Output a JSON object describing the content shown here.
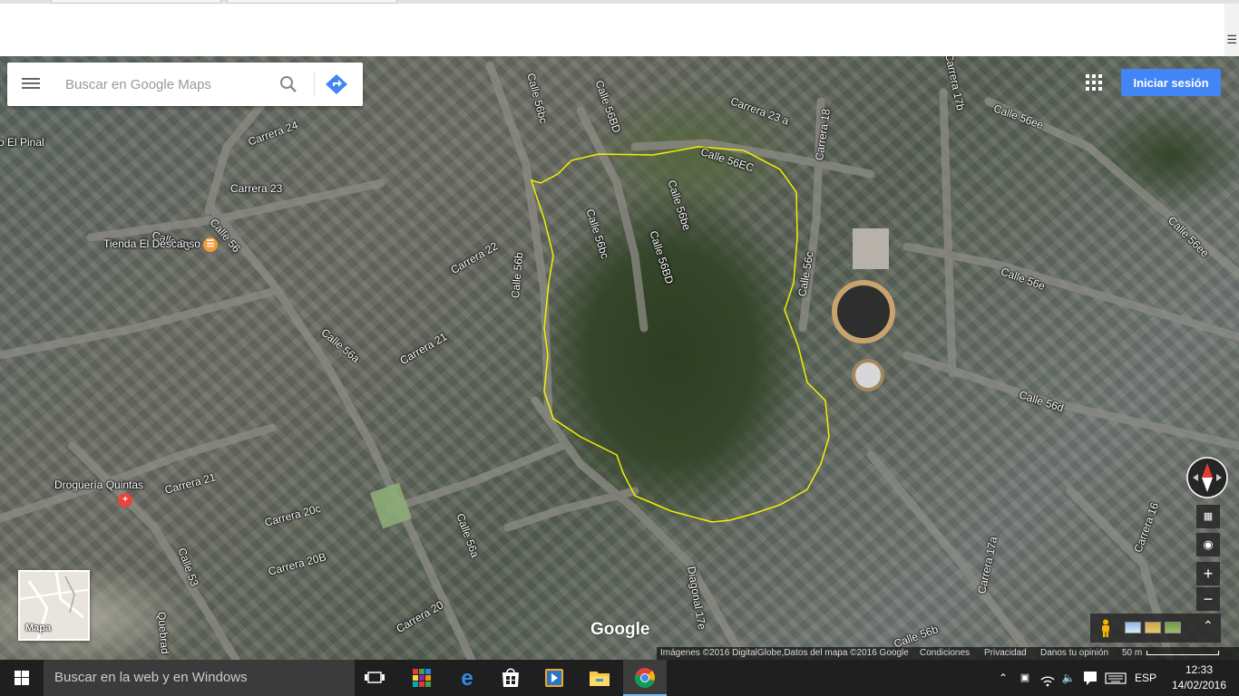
{
  "search": {
    "placeholder": "Buscar en Google Maps"
  },
  "header": {
    "signin_label": "Iniciar sesión"
  },
  "map_labels": [
    {
      "text": "o El Pinal"
    },
    {
      "text": "Carrera 24"
    },
    {
      "text": "Carrera 23"
    },
    {
      "text": "Calle 55"
    },
    {
      "text": "Calle 56"
    },
    {
      "text": "Carrera 22"
    },
    {
      "text": "Calle 56bc"
    },
    {
      "text": "Calle 56BD"
    },
    {
      "text": "Calle 56EC"
    },
    {
      "text": "Carrera 23 a"
    },
    {
      "text": "Carrera 18"
    },
    {
      "text": "Carrera 17b"
    },
    {
      "text": "Calle 56ee"
    },
    {
      "text": "Calle 56ee"
    },
    {
      "text": "Calle 56bc"
    },
    {
      "text": "Calle 56be"
    },
    {
      "text": "Calle 56BD"
    },
    {
      "text": "Calle 56b"
    },
    {
      "text": "Calle 56c"
    },
    {
      "text": "Calle 56e"
    },
    {
      "text": "Calle 56a"
    },
    {
      "text": "Carrera 21"
    },
    {
      "text": "Calle 56d"
    },
    {
      "text": "Carrera 21"
    },
    {
      "text": "Carrera 20c"
    },
    {
      "text": "Calle 53"
    },
    {
      "text": "Carrera 20B"
    },
    {
      "text": "Calle 56a"
    },
    {
      "text": "Carrera 20"
    },
    {
      "text": "Diagonal 17e"
    },
    {
      "text": "Carrera 17a"
    },
    {
      "text": "Carrera 16"
    },
    {
      "text": "Calle 56b"
    },
    {
      "text": "Quebrad"
    }
  ],
  "pois": [
    {
      "name": "Tienda El Descanso",
      "icon": "restaurant-icon",
      "color": "#f29c38"
    },
    {
      "name": "Droguería Quintas",
      "icon": "pharmacy-icon",
      "color": "#e8453c"
    }
  ],
  "minimap": {
    "label": "Mapa"
  },
  "logo": "Google",
  "footer": {
    "imagery": "Imágenes ©2016 DigitalGlobe,Datos del mapa ©2016 Google",
    "terms": "Condiciones",
    "privacy": "Privacidad",
    "feedback": "Danos tu opinión",
    "scale": "50 m"
  },
  "overlay": {
    "outline_color": "#f2f000"
  },
  "taskbar": {
    "search_placeholder": "Buscar en la web y en Windows",
    "apps": [
      "task-view-icon",
      "store-tiles-icon",
      "edge-icon",
      "store-icon",
      "media-player-icon",
      "file-explorer-icon",
      "chrome-icon"
    ],
    "language": "ESP",
    "time": "12:33",
    "date": "14/02/2016"
  }
}
